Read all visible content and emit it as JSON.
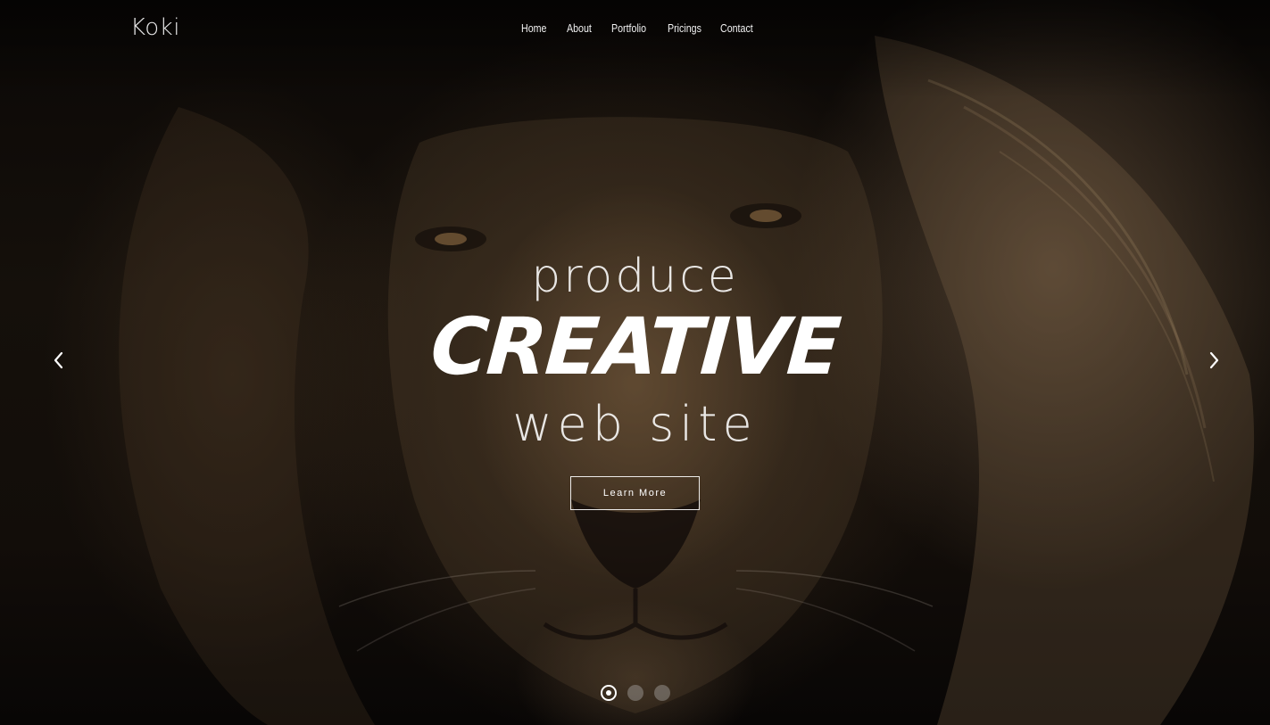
{
  "brand": {
    "logo": "Koki"
  },
  "nav": {
    "items": [
      {
        "label": "Home"
      },
      {
        "label": "About"
      },
      {
        "label": "Portfolio"
      },
      {
        "label": "Pricings"
      },
      {
        "label": "Contact"
      }
    ]
  },
  "hero": {
    "line1": "produce",
    "line2": "CREATIVE",
    "line3": "web site",
    "cta_label": "Learn More",
    "prev_icon": "chevron-left-icon",
    "next_icon": "chevron-right-icon",
    "slides_total": 3,
    "active_slide": 1
  },
  "colors": {
    "text": "#ffffff",
    "background": "#0b0806"
  }
}
